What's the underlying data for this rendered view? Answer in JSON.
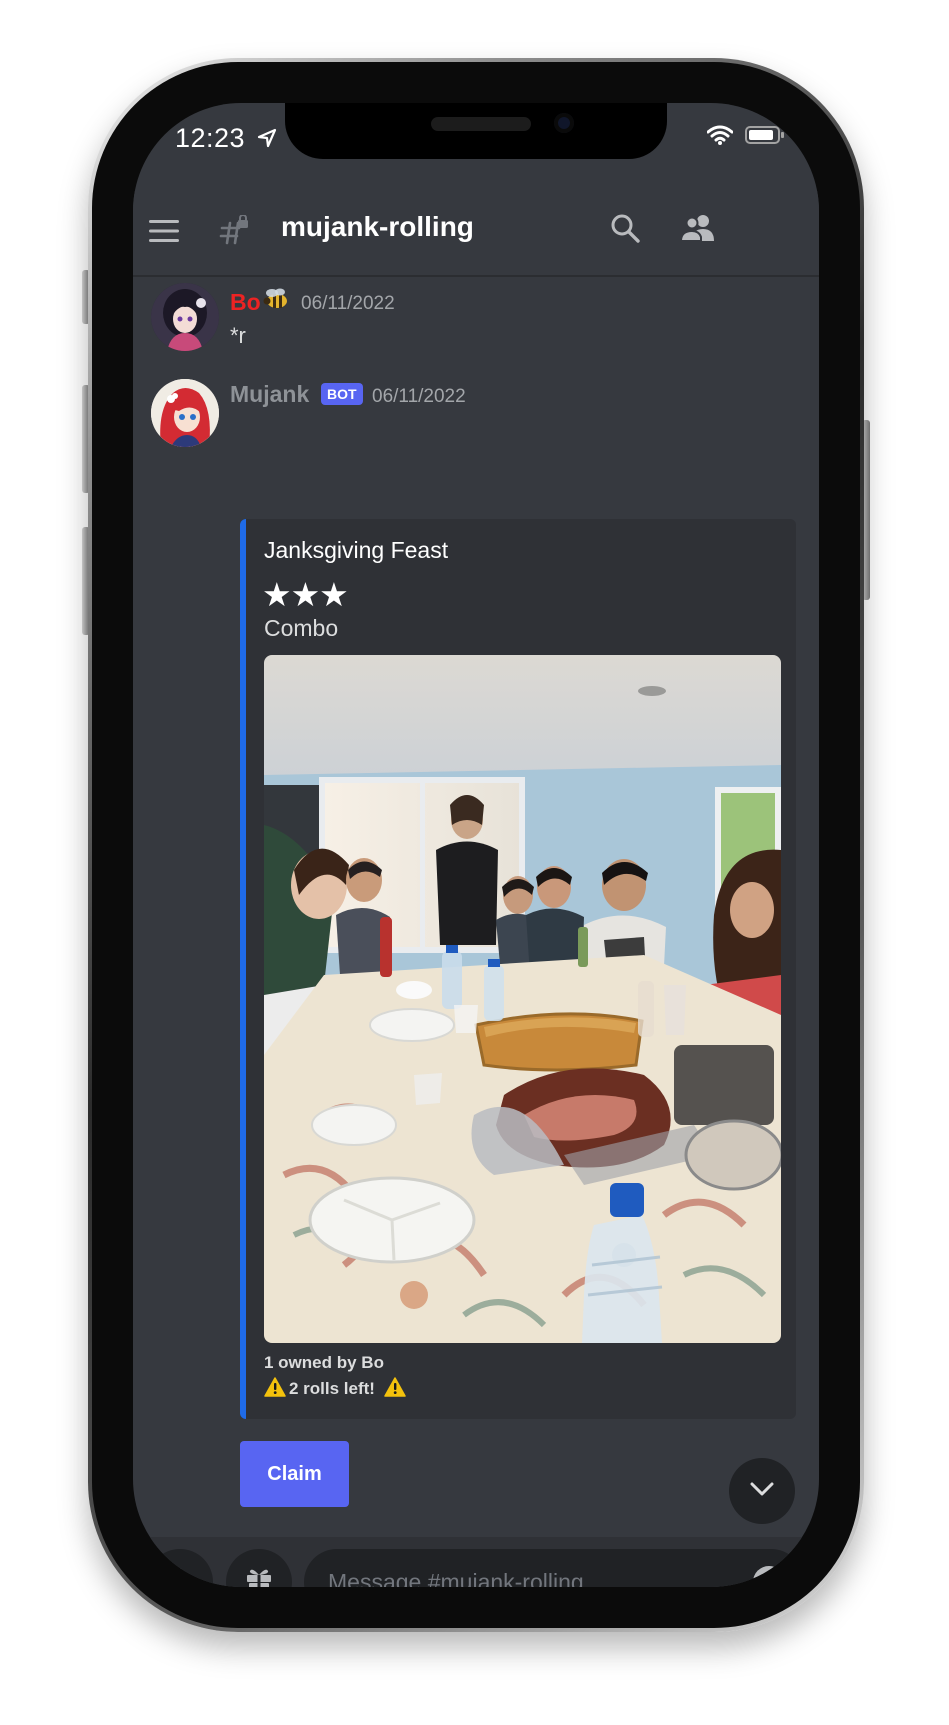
{
  "status_bar": {
    "time": "12:23"
  },
  "header": {
    "channel_name": "mujank-rolling"
  },
  "messages": [
    {
      "author": "Bo",
      "author_color": "#ed2323",
      "timestamp": "06/11/2022",
      "content": "*r"
    },
    {
      "author": "Mujank",
      "author_color": "#8e9297",
      "badge": "BOT",
      "timestamp": "06/11/2022",
      "embed": {
        "accent_color": "#1f6be8",
        "title": "Janksgiving Feast",
        "stars": "★★★",
        "description": "Combo",
        "footer_owner": "1 owned by Bo",
        "footer_rolls": "2 rolls left!"
      },
      "button_label": "Claim"
    }
  ],
  "composer": {
    "placeholder": "Message #mujank-rolling"
  },
  "colors": {
    "background": "#36393f",
    "blurple": "#5865f2",
    "input_bg": "#202225"
  }
}
